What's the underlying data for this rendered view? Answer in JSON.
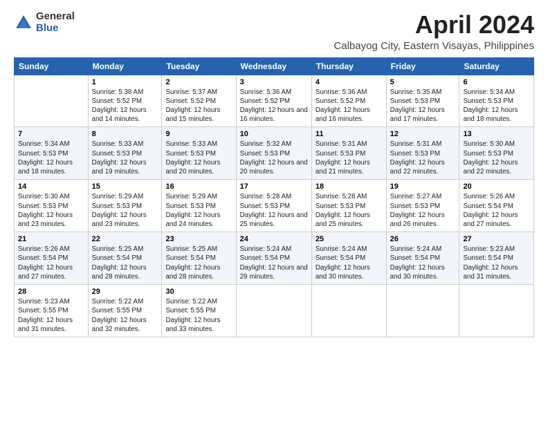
{
  "logo": {
    "general": "General",
    "blue": "Blue"
  },
  "title": "April 2024",
  "subtitle": "Calbayog City, Eastern Visayas, Philippines",
  "days_of_week": [
    "Sunday",
    "Monday",
    "Tuesday",
    "Wednesday",
    "Thursday",
    "Friday",
    "Saturday"
  ],
  "weeks": [
    [
      {
        "day": "",
        "sunrise": "",
        "sunset": "",
        "daylight": ""
      },
      {
        "day": "1",
        "sunrise": "Sunrise: 5:38 AM",
        "sunset": "Sunset: 5:52 PM",
        "daylight": "Daylight: 12 hours and 14 minutes."
      },
      {
        "day": "2",
        "sunrise": "Sunrise: 5:37 AM",
        "sunset": "Sunset: 5:52 PM",
        "daylight": "Daylight: 12 hours and 15 minutes."
      },
      {
        "day": "3",
        "sunrise": "Sunrise: 5:36 AM",
        "sunset": "Sunset: 5:52 PM",
        "daylight": "Daylight: 12 hours and 16 minutes."
      },
      {
        "day": "4",
        "sunrise": "Sunrise: 5:36 AM",
        "sunset": "Sunset: 5:52 PM",
        "daylight": "Daylight: 12 hours and 16 minutes."
      },
      {
        "day": "5",
        "sunrise": "Sunrise: 5:35 AM",
        "sunset": "Sunset: 5:53 PM",
        "daylight": "Daylight: 12 hours and 17 minutes."
      },
      {
        "day": "6",
        "sunrise": "Sunrise: 5:34 AM",
        "sunset": "Sunset: 5:53 PM",
        "daylight": "Daylight: 12 hours and 18 minutes."
      }
    ],
    [
      {
        "day": "7",
        "sunrise": "Sunrise: 5:34 AM",
        "sunset": "Sunset: 5:53 PM",
        "daylight": "Daylight: 12 hours and 18 minutes."
      },
      {
        "day": "8",
        "sunrise": "Sunrise: 5:33 AM",
        "sunset": "Sunset: 5:53 PM",
        "daylight": "Daylight: 12 hours and 19 minutes."
      },
      {
        "day": "9",
        "sunrise": "Sunrise: 5:33 AM",
        "sunset": "Sunset: 5:53 PM",
        "daylight": "Daylight: 12 hours and 20 minutes."
      },
      {
        "day": "10",
        "sunrise": "Sunrise: 5:32 AM",
        "sunset": "Sunset: 5:53 PM",
        "daylight": "Daylight: 12 hours and 20 minutes."
      },
      {
        "day": "11",
        "sunrise": "Sunrise: 5:31 AM",
        "sunset": "Sunset: 5:53 PM",
        "daylight": "Daylight: 12 hours and 21 minutes."
      },
      {
        "day": "12",
        "sunrise": "Sunrise: 5:31 AM",
        "sunset": "Sunset: 5:53 PM",
        "daylight": "Daylight: 12 hours and 22 minutes."
      },
      {
        "day": "13",
        "sunrise": "Sunrise: 5:30 AM",
        "sunset": "Sunset: 5:53 PM",
        "daylight": "Daylight: 12 hours and 22 minutes."
      }
    ],
    [
      {
        "day": "14",
        "sunrise": "Sunrise: 5:30 AM",
        "sunset": "Sunset: 5:53 PM",
        "daylight": "Daylight: 12 hours and 23 minutes."
      },
      {
        "day": "15",
        "sunrise": "Sunrise: 5:29 AM",
        "sunset": "Sunset: 5:53 PM",
        "daylight": "Daylight: 12 hours and 23 minutes."
      },
      {
        "day": "16",
        "sunrise": "Sunrise: 5:29 AM",
        "sunset": "Sunset: 5:53 PM",
        "daylight": "Daylight: 12 hours and 24 minutes."
      },
      {
        "day": "17",
        "sunrise": "Sunrise: 5:28 AM",
        "sunset": "Sunset: 5:53 PM",
        "daylight": "Daylight: 12 hours and 25 minutes."
      },
      {
        "day": "18",
        "sunrise": "Sunrise: 5:28 AM",
        "sunset": "Sunset: 5:53 PM",
        "daylight": "Daylight: 12 hours and 25 minutes."
      },
      {
        "day": "19",
        "sunrise": "Sunrise: 5:27 AM",
        "sunset": "Sunset: 5:53 PM",
        "daylight": "Daylight: 12 hours and 26 minutes."
      },
      {
        "day": "20",
        "sunrise": "Sunrise: 5:26 AM",
        "sunset": "Sunset: 5:54 PM",
        "daylight": "Daylight: 12 hours and 27 minutes."
      }
    ],
    [
      {
        "day": "21",
        "sunrise": "Sunrise: 5:26 AM",
        "sunset": "Sunset: 5:54 PM",
        "daylight": "Daylight: 12 hours and 27 minutes."
      },
      {
        "day": "22",
        "sunrise": "Sunrise: 5:25 AM",
        "sunset": "Sunset: 5:54 PM",
        "daylight": "Daylight: 12 hours and 28 minutes."
      },
      {
        "day": "23",
        "sunrise": "Sunrise: 5:25 AM",
        "sunset": "Sunset: 5:54 PM",
        "daylight": "Daylight: 12 hours and 28 minutes."
      },
      {
        "day": "24",
        "sunrise": "Sunrise: 5:24 AM",
        "sunset": "Sunset: 5:54 PM",
        "daylight": "Daylight: 12 hours and 29 minutes."
      },
      {
        "day": "25",
        "sunrise": "Sunrise: 5:24 AM",
        "sunset": "Sunset: 5:54 PM",
        "daylight": "Daylight: 12 hours and 30 minutes."
      },
      {
        "day": "26",
        "sunrise": "Sunrise: 5:24 AM",
        "sunset": "Sunset: 5:54 PM",
        "daylight": "Daylight: 12 hours and 30 minutes."
      },
      {
        "day": "27",
        "sunrise": "Sunrise: 5:23 AM",
        "sunset": "Sunset: 5:54 PM",
        "daylight": "Daylight: 12 hours and 31 minutes."
      }
    ],
    [
      {
        "day": "28",
        "sunrise": "Sunrise: 5:23 AM",
        "sunset": "Sunset: 5:55 PM",
        "daylight": "Daylight: 12 hours and 31 minutes."
      },
      {
        "day": "29",
        "sunrise": "Sunrise: 5:22 AM",
        "sunset": "Sunset: 5:55 PM",
        "daylight": "Daylight: 12 hours and 32 minutes."
      },
      {
        "day": "30",
        "sunrise": "Sunrise: 5:22 AM",
        "sunset": "Sunset: 5:55 PM",
        "daylight": "Daylight: 12 hours and 33 minutes."
      },
      {
        "day": "",
        "sunrise": "",
        "sunset": "",
        "daylight": ""
      },
      {
        "day": "",
        "sunrise": "",
        "sunset": "",
        "daylight": ""
      },
      {
        "day": "",
        "sunrise": "",
        "sunset": "",
        "daylight": ""
      },
      {
        "day": "",
        "sunrise": "",
        "sunset": "",
        "daylight": ""
      }
    ]
  ]
}
